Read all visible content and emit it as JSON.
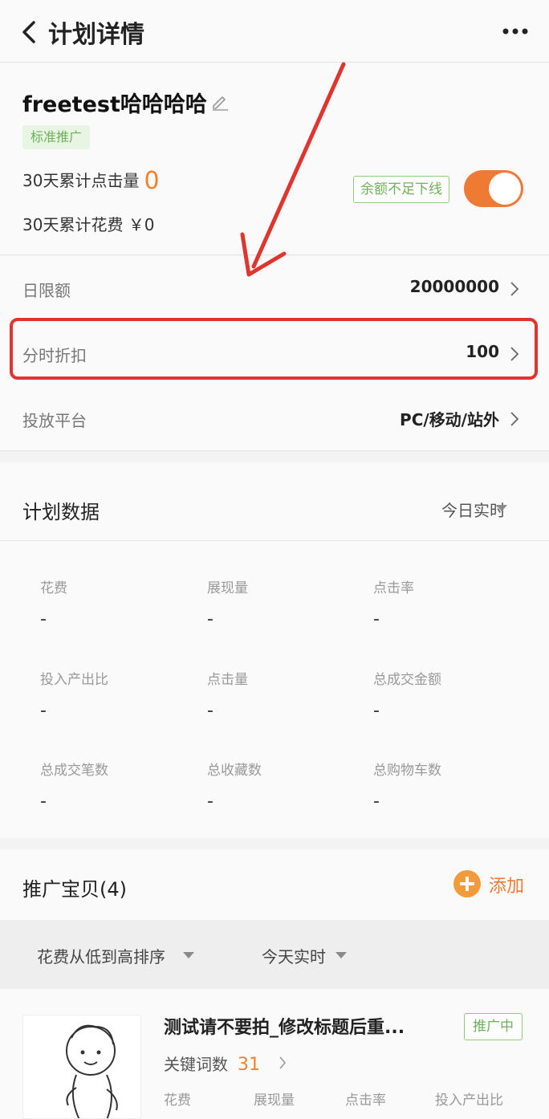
{
  "nav": {
    "title": "计划详情"
  },
  "plan": {
    "name": "freetest哈哈哈哈",
    "type_tag": "标准推广",
    "clicks_label": "30天累计点击量",
    "clicks_value": "0",
    "cost_label": "30天累计花费",
    "cost_value": "￥0",
    "balance_tag": "余额不足下线",
    "enabled": true
  },
  "settings": [
    {
      "label": "日限额",
      "value": "20000000"
    },
    {
      "label": "分时折扣",
      "value": "100"
    },
    {
      "label": "投放平台",
      "value": "PC/移动/站外"
    }
  ],
  "plan_data": {
    "title": "计划数据",
    "period": "今日实时",
    "metrics": [
      {
        "label": "花费",
        "value": "-"
      },
      {
        "label": "展现量",
        "value": "-"
      },
      {
        "label": "点击率",
        "value": "-"
      },
      {
        "label": "投入产出比",
        "value": "-"
      },
      {
        "label": "点击量",
        "value": "-"
      },
      {
        "label": "总成交金额",
        "value": "-"
      },
      {
        "label": "总成交笔数",
        "value": "-"
      },
      {
        "label": "总收藏数",
        "value": "-"
      },
      {
        "label": "总购物车数",
        "value": "-"
      }
    ]
  },
  "items": {
    "title": "推广宝贝(4)",
    "add_label": "添加",
    "sort_label": "花费从低到高排序",
    "period_label": "今天实时",
    "list": [
      {
        "title": "测试请不要拍_修改标题后重...",
        "status": "推广中",
        "keyword_label": "关键词数",
        "keyword_count": "31",
        "metric_labels": [
          "花费",
          "展现量",
          "点击率",
          "投入产出比"
        ]
      }
    ]
  },
  "colors": {
    "accent": "#ee7a34",
    "green": "#6fb05a",
    "annotation_red": "#e0342e"
  }
}
